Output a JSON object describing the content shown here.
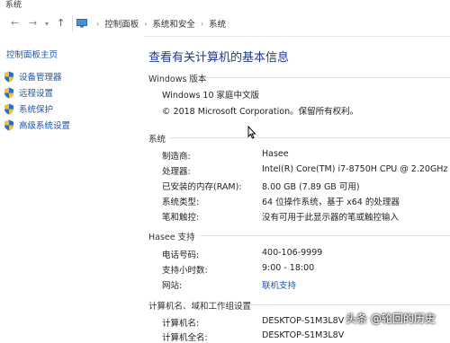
{
  "window": {
    "title": "系统"
  },
  "address_bar": {
    "crumbs": [
      "控制面板",
      "系统和安全",
      "系统"
    ]
  },
  "sidebar": {
    "home_link": "控制面板主页",
    "tasks": [
      {
        "label": "设备管理器",
        "icon": "shield-icon"
      },
      {
        "label": "远程设置",
        "icon": "shield-icon"
      },
      {
        "label": "系统保护",
        "icon": "shield-icon"
      },
      {
        "label": "高级系统设置",
        "icon": "shield-icon"
      }
    ]
  },
  "main": {
    "heading": "查看有关计算机的基本信息",
    "windows_edition": {
      "title": "Windows 版本",
      "edition": "Windows 10 家庭中文版",
      "copyright": "© 2018 Microsoft Corporation。保留所有权利。"
    },
    "system": {
      "title": "系统",
      "rows": [
        {
          "label": "制造商:",
          "value": "Hasee"
        },
        {
          "label": "处理器:",
          "value": "Intel(R) Core(TM) i7-8750H CPU @ 2.20GHz   2.20"
        },
        {
          "label": "已安装的内存(RAM):",
          "value": "8.00 GB (7.89 GB 可用)"
        },
        {
          "label": "系统类型:",
          "value": "64 位操作系统，基于 x64 的处理器"
        },
        {
          "label": "笔和触控:",
          "value": "没有可用于此显示器的笔或触控输入"
        }
      ]
    },
    "support": {
      "title": "Hasee 支持",
      "rows": [
        {
          "label": "电话号码:",
          "value": "400-106-9999"
        },
        {
          "label": "支持小时数:",
          "value": "9:00 - 18:00"
        },
        {
          "label": "网站:",
          "value": "联机支持"
        }
      ]
    },
    "computer": {
      "title": "计算机名、域和工作组设置",
      "rows": [
        {
          "label": "计算机名:",
          "value": "DESKTOP-S1M3L8V"
        },
        {
          "label": "计算机全名:",
          "value": "DESKTOP-S1M3L8V"
        }
      ]
    }
  },
  "watermark": "头条 @轮回的历史",
  "colors": {
    "link": "#1a55b0",
    "heading": "#1e3b8a"
  }
}
